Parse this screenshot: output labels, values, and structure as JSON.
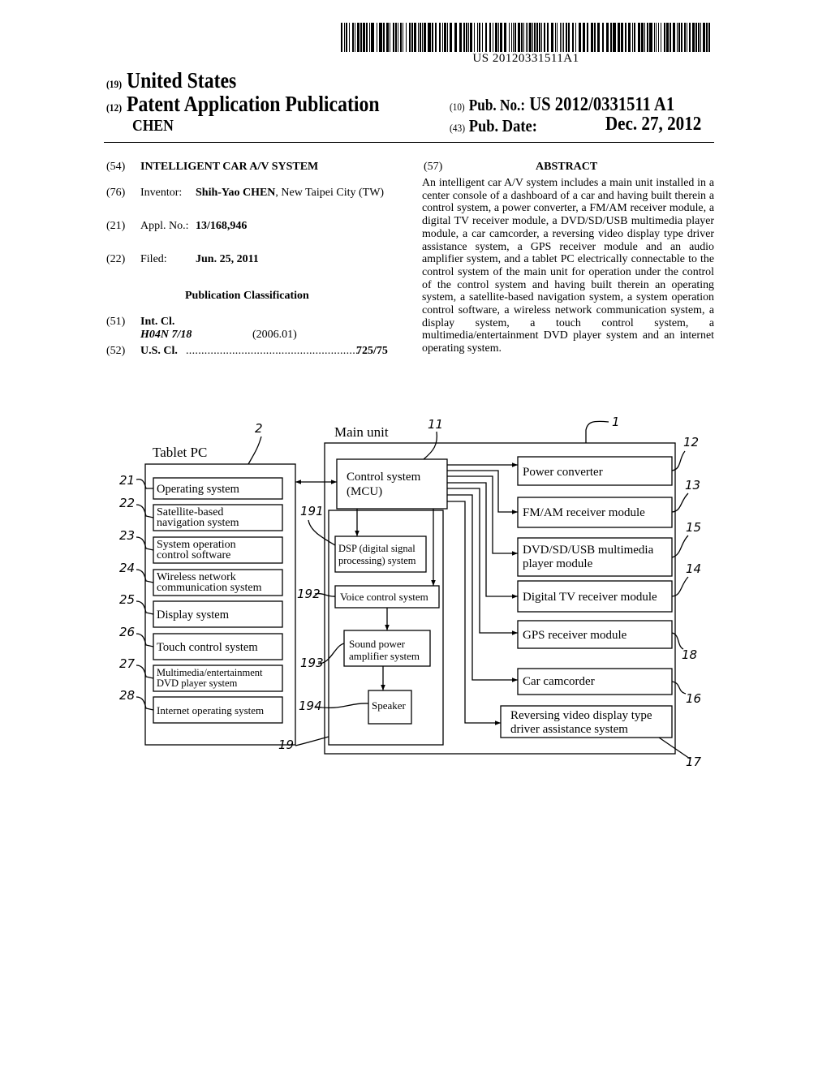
{
  "header": {
    "barcode_number": "US 20120331511A1",
    "country_code": "(19)",
    "country": "United States",
    "pubtype_code": "(12)",
    "pub_type": "Patent Application Publication",
    "inventor_surname": "CHEN",
    "pub_no_code": "(10)",
    "pub_no_label": "Pub. No.:",
    "pub_no": "US 2012/0331511 A1",
    "pub_date_code": "(43)",
    "pub_date_label": "Pub. Date:",
    "pub_date": "Dec. 27, 2012"
  },
  "biblio": {
    "title_code": "(54)",
    "title": "INTELLIGENT CAR A/V SYSTEM",
    "inventor_code": "(76)",
    "inventor_label": "Inventor:",
    "inventor_name": "Shih-Yao CHEN",
    "inventor_location": ", New Taipei City (TW)",
    "appl_code": "(21)",
    "appl_label": "Appl. No.:",
    "appl_no": "13/168,946",
    "filed_code": "(22)",
    "filed_label": "Filed:",
    "filed_date": "Jun. 25, 2011",
    "classification_title": "Publication Classification",
    "intcl_code": "(51)",
    "intcl_label": "Int. Cl.",
    "intcl_class": "H04N 7/18",
    "intcl_version": "(2006.01)",
    "uscl_code": "(52)",
    "uscl_label": "U.S. Cl.",
    "uscl_dots": "........................................................",
    "uscl_value": "725/75"
  },
  "abstract": {
    "code": "(57)",
    "title": "ABSTRACT",
    "text": "An intelligent car A/V system includes a main unit installed in a center console of a dashboard of a car and having built therein a control system, a power converter, a FM/AM receiver module, a digital TV receiver module, a DVD/SD/USB multimedia player module, a car camcorder, a reversing video display type driver assistance system, a GPS receiver module and an audio amplifier system, and a tablet PC electrically connectable to the control system of the main unit for operation under the control of the control system and having built therein an operating system, a satellite-based navigation system, a system operation control software, a wireless network communication system, a display system, a touch control system, a multimedia/entertainment DVD player system and an internet operating system."
  },
  "figure": {
    "tablet_title": "Tablet PC",
    "tablet_ref": "2",
    "tablet_items": [
      {
        "ref": "21",
        "lines": [
          "Operating system"
        ]
      },
      {
        "ref": "22",
        "lines": [
          "Satellite-based",
          "navigation system"
        ]
      },
      {
        "ref": "23",
        "lines": [
          "System operation",
          "control software"
        ]
      },
      {
        "ref": "24",
        "lines": [
          "Wireless network",
          "communication system"
        ]
      },
      {
        "ref": "25",
        "lines": [
          "Display system"
        ]
      },
      {
        "ref": "26",
        "lines": [
          "Touch control system"
        ]
      },
      {
        "ref": "27",
        "lines": [
          "Multimedia/entertainment",
          "DVD player system"
        ]
      },
      {
        "ref": "28",
        "lines": [
          "Internet operating system"
        ]
      }
    ],
    "main_title": "Main unit",
    "main_ref": "1",
    "control": {
      "ref": "11",
      "lines": [
        "Control system",
        "(MCU)"
      ]
    },
    "audio_ref": "19",
    "audio_items": [
      {
        "ref": "191",
        "lines": [
          "DSP (digital signal",
          "processing) system"
        ]
      },
      {
        "ref": "192",
        "lines": [
          "Voice control system"
        ]
      },
      {
        "ref": "193",
        "lines": [
          "Sound power",
          "amplifier system"
        ]
      },
      {
        "ref": "194",
        "lines": [
          "Speaker"
        ]
      }
    ],
    "modules": [
      {
        "ref": "12",
        "lines": [
          "Power converter"
        ]
      },
      {
        "ref": "13",
        "lines": [
          "FM/AM receiver module"
        ]
      },
      {
        "ref": "15",
        "lines": [
          "DVD/SD/USB multimedia",
          "player  module"
        ]
      },
      {
        "ref": "14",
        "lines": [
          "Digital TV receiver module"
        ]
      },
      {
        "ref": "18",
        "lines": [
          "GPS receiver module"
        ]
      },
      {
        "ref": "16",
        "lines": [
          "Car camcorder"
        ]
      },
      {
        "ref": "17",
        "lines": [
          "Reversing video display type",
          "driver assistance system"
        ]
      }
    ]
  }
}
